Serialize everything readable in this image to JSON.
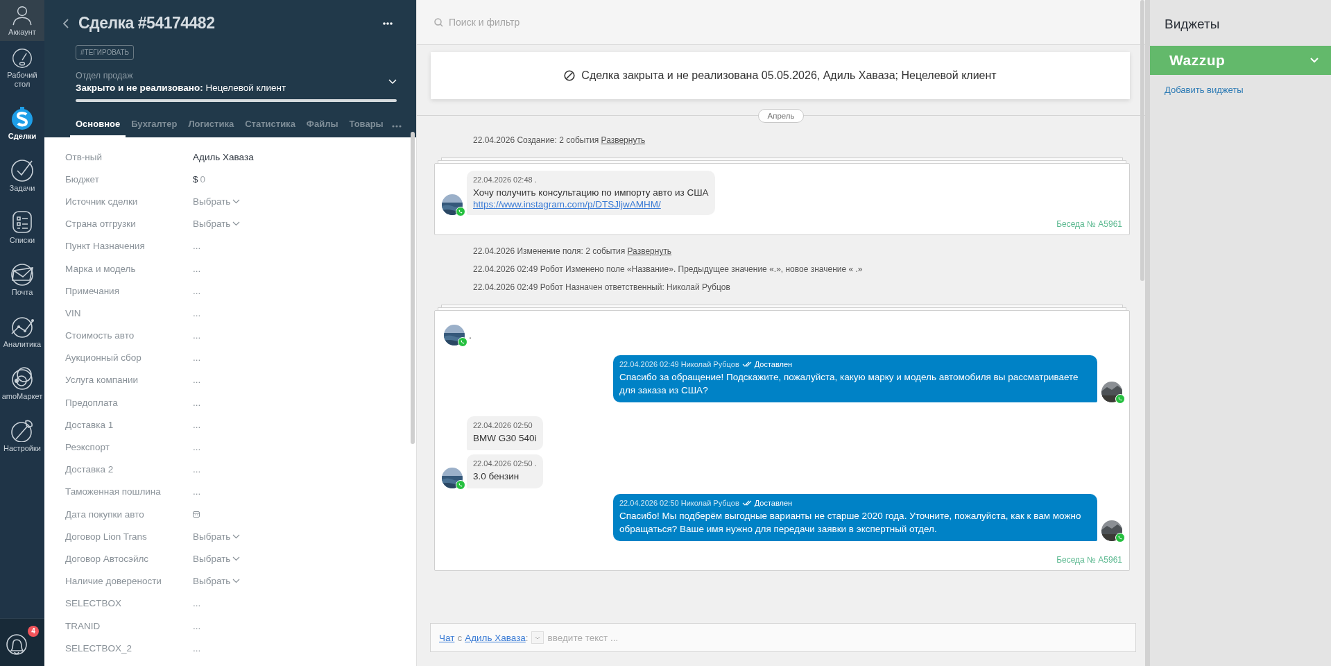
{
  "nav": {
    "items": [
      {
        "kind": "account",
        "label": "Аккаунт",
        "selected": false
      },
      {
        "kind": "dashboard",
        "label": "Рабочий стол",
        "selected": false
      },
      {
        "kind": "deals",
        "label": "Сделки",
        "selected": true
      },
      {
        "kind": "tasks",
        "label": "Задачи",
        "selected": false
      },
      {
        "kind": "lists",
        "label": "Списки",
        "selected": false
      },
      {
        "kind": "mail",
        "label": "Почта",
        "selected": false
      },
      {
        "kind": "analytics",
        "label": "Аналитика",
        "selected": false
      },
      {
        "kind": "market",
        "label": "amoМаркет",
        "selected": false
      },
      {
        "kind": "settings",
        "label": "Настройки",
        "selected": false
      }
    ],
    "notifications_badge": "4"
  },
  "deal": {
    "title": "Сделка #54174482",
    "tag_button": "#ТЕГИРОВАТЬ",
    "pipeline": "Отдел продаж",
    "status": "**Закрыто и не реализовано:** Нецелевой клиент",
    "tabs": [
      {
        "label": "Основное",
        "selected": true
      },
      {
        "label": "Бухгалтер",
        "selected": false
      },
      {
        "label": "Логистика",
        "selected": false
      },
      {
        "label": "Статистика",
        "selected": false
      },
      {
        "label": "Файлы",
        "selected": false
      },
      {
        "label": "Товары",
        "selected": false
      }
    ],
    "fields": [
      {
        "label": "Отв-ный",
        "kind": "text",
        "value": "Адиль Хаваза"
      },
      {
        "label": "Бюджет",
        "kind": "money",
        "currency": "$",
        "value": "0"
      },
      {
        "label": "Источник сделки",
        "kind": "select",
        "value": "Выбрать"
      },
      {
        "label": "Страна отгрузки",
        "kind": "select",
        "value": "Выбрать"
      },
      {
        "label": "Пункт Назначения",
        "kind": "empty",
        "value": "..."
      },
      {
        "label": "Марка и модель",
        "kind": "empty",
        "value": "..."
      },
      {
        "label": "Примечания",
        "kind": "empty",
        "value": "..."
      },
      {
        "label": "VIN",
        "kind": "empty",
        "value": "..."
      },
      {
        "label": "Стоимость авто",
        "kind": "empty",
        "value": "..."
      },
      {
        "label": "Аукционный сбор",
        "kind": "empty",
        "value": "..."
      },
      {
        "label": "Услуга компании",
        "kind": "empty",
        "value": "..."
      },
      {
        "label": "Предоплата",
        "kind": "empty",
        "value": "..."
      },
      {
        "label": "Доставка 1",
        "kind": "empty",
        "value": "..."
      },
      {
        "label": "Реэкспорт",
        "kind": "empty",
        "value": "..."
      },
      {
        "label": "Доставка 2",
        "kind": "empty",
        "value": "..."
      },
      {
        "label": "Таможенная пошлина",
        "kind": "empty",
        "value": "..."
      },
      {
        "label": "Дата покупки авто",
        "kind": "date"
      },
      {
        "label": "Договор Lion Trans",
        "kind": "select",
        "value": "Выбрать"
      },
      {
        "label": "Договор Автосэйлс",
        "kind": "select",
        "value": "Выбрать"
      },
      {
        "label": "Наличие доверености",
        "kind": "select",
        "value": "Выбрать"
      },
      {
        "label": "SELECTBOX",
        "kind": "empty",
        "value": "..."
      },
      {
        "label": "TRANID",
        "kind": "empty",
        "value": "..."
      },
      {
        "label": "SELECTBOX_2",
        "kind": "empty",
        "value": "..."
      }
    ]
  },
  "feed": {
    "search_placeholder": "Поиск и фильтр",
    "notice": "Сделка закрыта и не реализована 05.05.2026, Адиль Хаваза; Нецелевой клиент",
    "month": "Апрель",
    "items": [
      {
        "kind": "event",
        "text": "22.04.2026 Создание: 2 события",
        "link": "Развернуть"
      },
      {
        "kind": "chat",
        "footer": "Беседа № A5961",
        "messages": [
          {
            "kind": "in",
            "meta": "22.04.2026 02:48 .",
            "text": "Хочу получить консультацию по импорту авто из США",
            "link": "https://www.instagram.com/p/DTSJljwAMHM/",
            "avatar": true
          }
        ]
      },
      {
        "kind": "event",
        "text": "22.04.2026 Изменение поля: 2 события",
        "link": "Развернуть"
      },
      {
        "kind": "event",
        "text": "22.04.2026 02:49 Робот Изменено поле «Название». Предыдущее значение «.», новое значение « .»"
      },
      {
        "kind": "event",
        "text": "22.04.2026 02:49 Робот Назначен ответственный: Николай Рубцов"
      },
      {
        "kind": "chat",
        "footer": "Беседа № A5961",
        "messages": [
          {
            "kind": "plain",
            "text": ".",
            "avatar": true
          },
          {
            "kind": "out",
            "meta": "22.04.2026 02:49 Николай Рубцов",
            "status": "Доставлен",
            "text": "Спасибо за обращение! Подскажите, пожалуйста, какую марку и модель автомобиля вы рассматриваете для заказа из США?",
            "avatar": true
          },
          {
            "kind": "in",
            "meta": "22.04.2026 02:50",
            "text": "BMW G30 540i",
            "avatar": false
          },
          {
            "kind": "in",
            "meta": "22.04.2026 02:50 .",
            "text": "3.0 бензин",
            "avatar": true
          },
          {
            "kind": "out",
            "meta": "22.04.2026 02:50 Николай Рубцов",
            "status": "Доставлен",
            "text": "Спасибо! Мы подберём выгодные варианты не старше 2020 года. Уточните, пожалуйста, как к вам можно обращаться? Ваше имя нужно для передачи заявки в экспертный отдел.",
            "avatar": true
          }
        ]
      }
    ],
    "composer": {
      "chat_link": "Чат",
      "with": "с",
      "contact_link": "Адиль Хаваза",
      "colon": ":",
      "placeholder": "введите текст ..."
    }
  },
  "widgets": {
    "title": "Виджеты",
    "items": [
      {
        "label": "Wazzup",
        "expanded": false
      }
    ],
    "add_link": "Добавить виджеты"
  }
}
